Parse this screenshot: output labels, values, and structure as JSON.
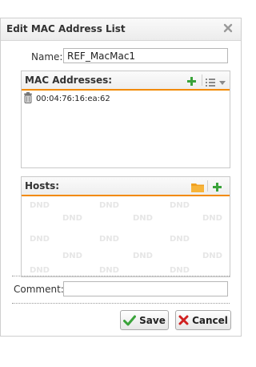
{
  "dialog": {
    "title": "Edit MAC Address List",
    "close_icon": "close-x-icon"
  },
  "name_field": {
    "label": "Name:",
    "value": "REF_MacMac1"
  },
  "mac_panel": {
    "title": "MAC Addresses:",
    "add_icon": "plus-icon",
    "menu_icon": "list-menu-icon",
    "items": [
      {
        "icon": "trash-icon",
        "text": "00:04:76:16:ea:62"
      }
    ]
  },
  "hosts_panel": {
    "title": "Hosts:",
    "folder_icon": "folder-icon",
    "add_icon": "plus-icon",
    "placeholder": "DND"
  },
  "comment_field": {
    "label": "Comment:",
    "value": ""
  },
  "buttons": {
    "save": "Save",
    "cancel": "Cancel"
  },
  "colors": {
    "accent": "#f28a00",
    "add_green": "#3aa33a",
    "cancel_red": "#d02020"
  }
}
